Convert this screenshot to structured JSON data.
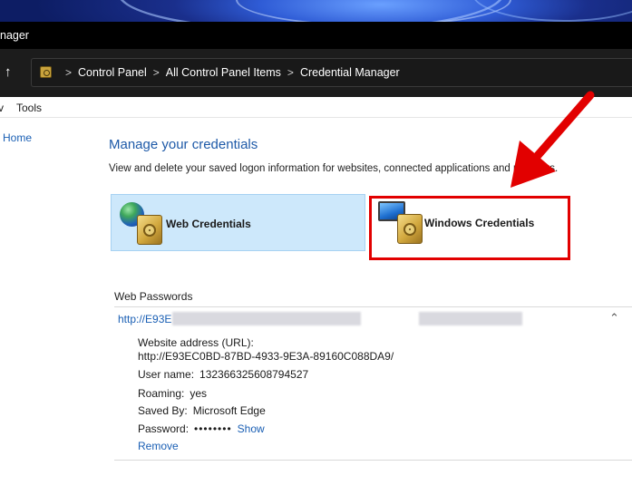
{
  "window": {
    "title": "nager"
  },
  "address": {
    "crumbs": [
      "Control Panel",
      "All Control Panel Items",
      "Credential Manager"
    ],
    "separator": ">"
  },
  "menu": {
    "items": [
      "v",
      "Tools"
    ]
  },
  "left_pane": {
    "home_label": "Home"
  },
  "main": {
    "heading": "Manage your credentials",
    "description": "View and delete your saved logon information for websites, connected applications and networks.",
    "tiles": [
      {
        "label": "Web Credentials",
        "selected": true
      },
      {
        "label": "Windows Credentials",
        "selected": false
      }
    ]
  },
  "web_passwords": {
    "section_title": "Web Passwords",
    "entry": {
      "url_short": "http://E93E",
      "expanded": true,
      "fields": {
        "address_label": "Website address (URL):",
        "address_value": "http://E93EC0BD-87BD-4933-9E3A-89160C088DA9/",
        "username_label": "User name:",
        "username_value": "132366325608794527",
        "roaming_label": "Roaming:",
        "roaming_value": "yes",
        "saved_by_label": "Saved By:",
        "saved_by_value": "Microsoft Edge",
        "password_label": "Password:",
        "password_value": "••••••••",
        "show_label": "Show",
        "remove_label": "Remove"
      }
    }
  },
  "annotation": {
    "highlight_color": "#e20000",
    "arrow_color": "#e20000"
  },
  "colors": {
    "link": "#1a5fb4",
    "heading": "#1e5aa8",
    "selected_tile": "#cde8fb"
  }
}
